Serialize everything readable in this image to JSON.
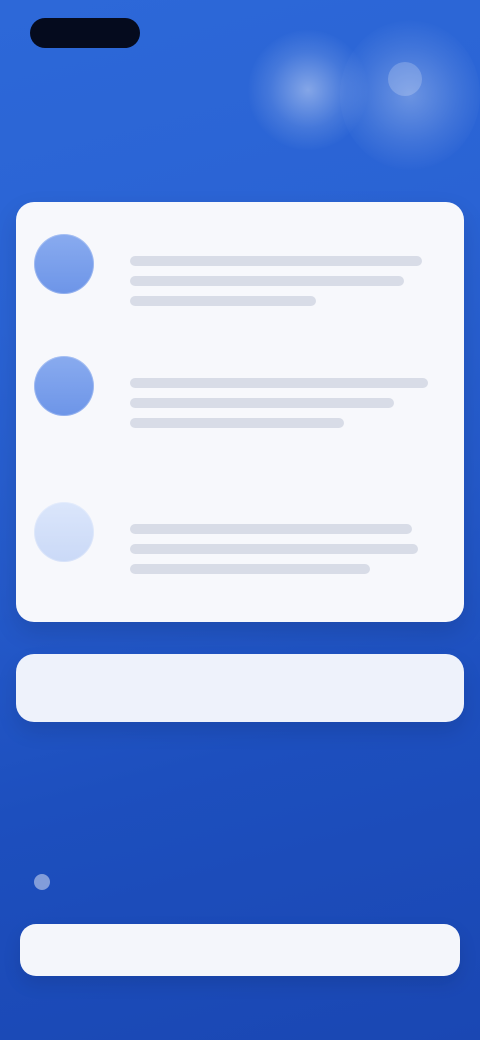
{
  "header": {
    "top_right_label": "",
    "section_heading": ""
  },
  "card": {
    "items": [
      {
        "title": "",
        "body": ""
      },
      {
        "title": "",
        "body": ""
      },
      {
        "title": "",
        "body": ""
      }
    ]
  },
  "banner": {
    "text": ""
  },
  "lower": {
    "label": "",
    "subtext": ""
  },
  "footer": {
    "action_label": ""
  },
  "colors": {
    "background": "#2a63d4",
    "card": "#f7f8fc",
    "accent": "#6d95e8",
    "dark_pill": "#050b1e"
  },
  "icons": {
    "top_right": "profile-icon",
    "item_1": "avatar-icon",
    "item_2": "avatar-icon",
    "item_3": "avatar-icon",
    "lower": "info-icon"
  }
}
